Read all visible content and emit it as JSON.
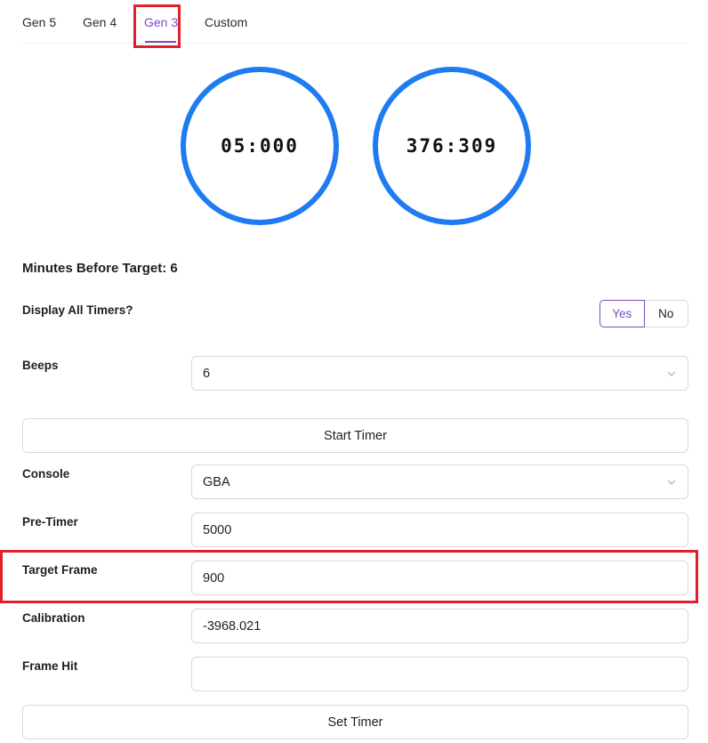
{
  "tabs": [
    {
      "label": "Gen 5",
      "active": false
    },
    {
      "label": "Gen 4",
      "active": false
    },
    {
      "label": "Gen 3",
      "active": true
    },
    {
      "label": "Custom",
      "active": false
    }
  ],
  "timers": {
    "primary": "05:000",
    "secondary": "376:309"
  },
  "heading": "Minutes Before Target: 6",
  "display_all_timers": {
    "label": "Display All Timers?",
    "yes_label": "Yes",
    "no_label": "No",
    "selected": "Yes"
  },
  "beeps": {
    "label": "Beeps",
    "value": "6"
  },
  "start_button": "Start Timer",
  "console": {
    "label": "Console",
    "value": "GBA"
  },
  "pre_timer": {
    "label": "Pre-Timer",
    "value": "5000"
  },
  "target_frame": {
    "label": "Target Frame",
    "value": "900"
  },
  "calibration": {
    "label": "Calibration",
    "value": "-3968.021"
  },
  "frame_hit": {
    "label": "Frame Hit",
    "value": ""
  },
  "set_button": "Set Timer",
  "colors": {
    "accent": "#7a4cc2",
    "circle": "#1f7bf2",
    "highlight": "#e0202a"
  },
  "icons": {
    "select_chevron": "chevron-down-icon"
  }
}
